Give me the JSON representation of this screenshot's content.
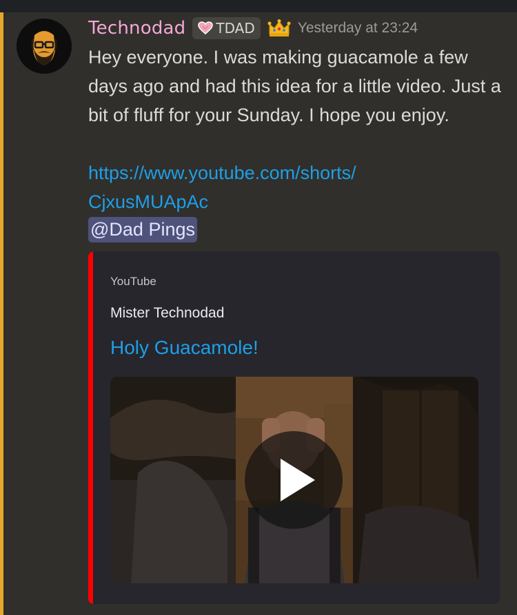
{
  "message": {
    "username": "Technodad",
    "role_tag": "TDAD",
    "timestamp": "Yesterday at 23:24",
    "text": "Hey everyone. I was making guacamole a few days ago and had this idea for a little video. Just a bit of fluff for your Sunday. I hope you enjoy.",
    "link_line1": "https://www.youtube.com/shorts/",
    "link_line2": "CjxusMUApAc",
    "mention": "@Dad Pings"
  },
  "embed": {
    "provider": "YouTube",
    "author": "Mister Technodad",
    "title": "Holy Guacamole!"
  },
  "icons": {
    "avatar": "bearded-man-glasses-avatar",
    "tag_icon": "heart-icon",
    "badge": "crown-icon",
    "video_control": "play-icon"
  },
  "colors": {
    "username": "#f3a8d6",
    "link": "#1e9fe8",
    "mention_bg": "#4f527a",
    "embed_accent": "#ff0000",
    "left_accent": "#e6a72c"
  }
}
